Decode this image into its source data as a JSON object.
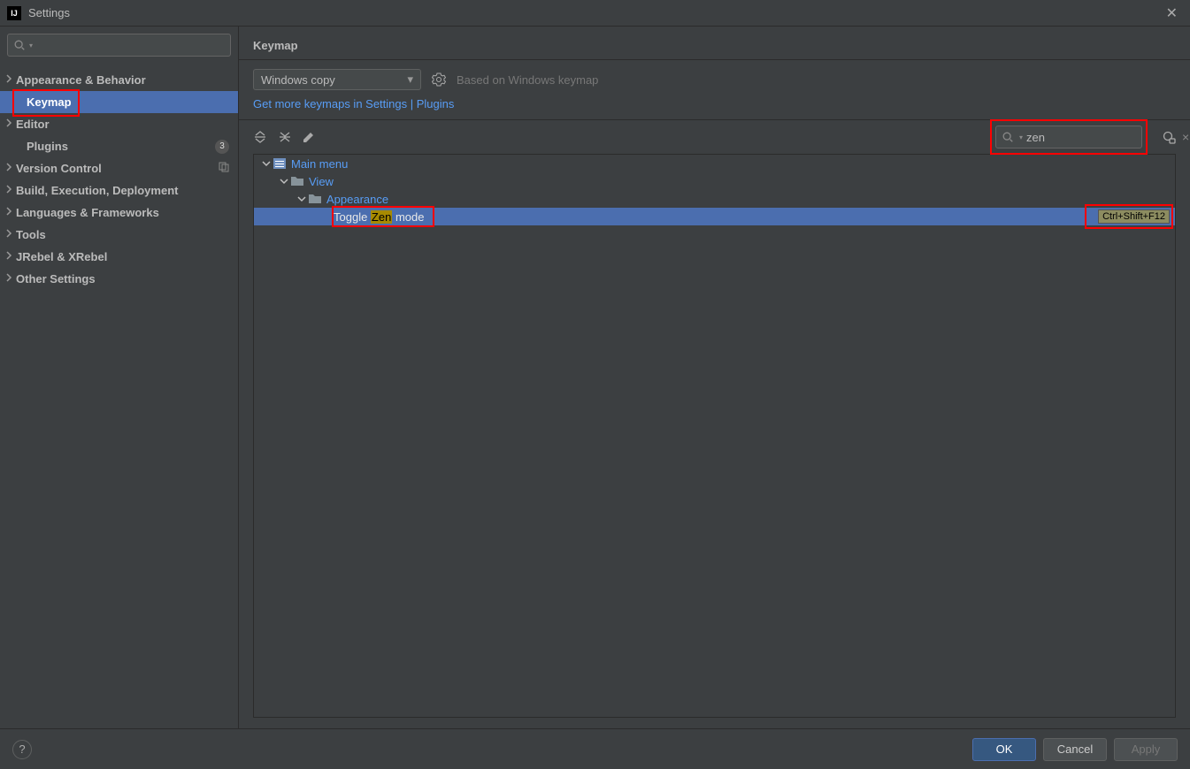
{
  "titlebar": {
    "title": "Settings",
    "app_icon_text": "IJ"
  },
  "sidebar": {
    "search_placeholder": "",
    "items": [
      {
        "label": "Appearance & Behavior",
        "expandable": true
      },
      {
        "label": "Keymap",
        "expandable": false,
        "selected": true,
        "highlight": true
      },
      {
        "label": "Editor",
        "expandable": true
      },
      {
        "label": "Plugins",
        "expandable": false,
        "badge": "3"
      },
      {
        "label": "Version Control",
        "expandable": true,
        "right_icon": "copy"
      },
      {
        "label": "Build, Execution, Deployment",
        "expandable": true
      },
      {
        "label": "Languages & Frameworks",
        "expandable": true
      },
      {
        "label": "Tools",
        "expandable": true
      },
      {
        "label": "JRebel & XRebel",
        "expandable": true
      },
      {
        "label": "Other Settings",
        "expandable": true
      }
    ]
  },
  "main": {
    "title": "Keymap",
    "combo_value": "Windows copy",
    "based_on": "Based on Windows keymap",
    "link_text": "Get more keymaps in Settings | Plugins",
    "search_value": "zen",
    "tree": {
      "root": {
        "label": "Main menu"
      },
      "view": {
        "label": "View"
      },
      "appearance": {
        "label": "Appearance"
      },
      "action_prefix": "Toggle ",
      "action_highlight": "Zen",
      "action_suffix": " mode",
      "shortcut": "Ctrl+Shift+F12"
    }
  },
  "footer": {
    "ok": "OK",
    "cancel": "Cancel",
    "apply": "Apply"
  }
}
